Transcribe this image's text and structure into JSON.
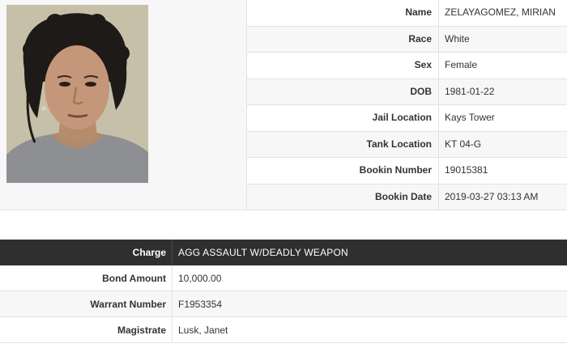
{
  "inmate": {
    "fields": [
      {
        "label": "Name",
        "value": "ZELAYAGOMEZ, MIRIAN"
      },
      {
        "label": "Race",
        "value": "White"
      },
      {
        "label": "Sex",
        "value": "Female"
      },
      {
        "label": "DOB",
        "value": "1981-01-22"
      },
      {
        "label": "Jail Location",
        "value": "Kays Tower"
      },
      {
        "label": "Tank Location",
        "value": "KT 04-G"
      },
      {
        "label": "Bookin Number",
        "value": "19015381"
      },
      {
        "label": "Bookin Date",
        "value": "2019-03-27 03:13 AM"
      }
    ]
  },
  "charge": {
    "header": {
      "label": "Charge",
      "value": "AGG ASSAULT W/DEADLY WEAPON"
    },
    "rows": [
      {
        "label": "Bond Amount",
        "value": "10,000.00"
      },
      {
        "label": "Warrant Number",
        "value": "F1953354"
      },
      {
        "label": "Magistrate",
        "value": "Lusk, Janet"
      }
    ]
  },
  "colors": {
    "header_bg": "#2f2f2f",
    "stripe_bg": "#f7f7f7",
    "border": "#e2e2e2"
  }
}
